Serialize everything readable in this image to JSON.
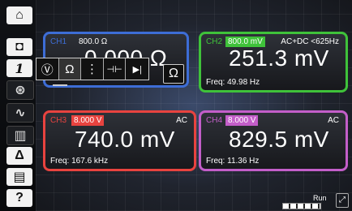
{
  "sidebar": {
    "items": [
      {
        "name": "home-icon",
        "glyph": "⌂"
      },
      {
        "name": "tape-icon",
        "glyph": "◘"
      },
      {
        "name": "channel-number",
        "glyph": "1"
      },
      {
        "name": "probe-icon",
        "glyph": "⊛"
      },
      {
        "name": "waveform-icon",
        "glyph": "∿"
      },
      {
        "name": "chart-icon",
        "glyph": "▥"
      },
      {
        "name": "delta-icon",
        "glyph": "Δ"
      },
      {
        "name": "save-icon",
        "glyph": "▤"
      },
      {
        "name": "help-icon",
        "glyph": "?"
      }
    ]
  },
  "function_bar": {
    "items": [
      {
        "name": "voltage-func-icon",
        "glyph": "Ⓥ"
      },
      {
        "name": "resistance-func-icon",
        "glyph": "Ω"
      },
      {
        "name": "diode-graph-func-icon",
        "glyph": "⋮"
      },
      {
        "name": "capacitor-func-icon",
        "glyph": "⊣⊢"
      },
      {
        "name": "diode-func-icon",
        "glyph": "▶|"
      }
    ]
  },
  "unit_button": "Ω",
  "channels": [
    {
      "label": "CH1",
      "range": "800.0 Ω",
      "coupling": "",
      "value": "0.000 Ω",
      "freq": "",
      "color": "#3d6dd6",
      "range_bg": "transparent"
    },
    {
      "label": "CH2",
      "range": "800.0 mV",
      "coupling": "AC+DC <625Hz",
      "value": "251.3 mV",
      "freq": "Freq: 49.98 Hz",
      "color": "#3fc23a",
      "range_bg": "#3fc23a"
    },
    {
      "label": "CH3",
      "range": "8.000 V",
      "coupling": "AC",
      "value": "740.0 mV",
      "freq": "Freq: 167.6 kHz",
      "color": "#e8433f",
      "range_bg": "#e8433f"
    },
    {
      "label": "CH4",
      "range": "8.000 V",
      "coupling": "AC",
      "value": "829.5 mV",
      "freq": "Freq: 11.36 Hz",
      "color": "#c35ec9",
      "range_bg": "#c35ec9"
    }
  ],
  "status": {
    "run": "Run"
  }
}
